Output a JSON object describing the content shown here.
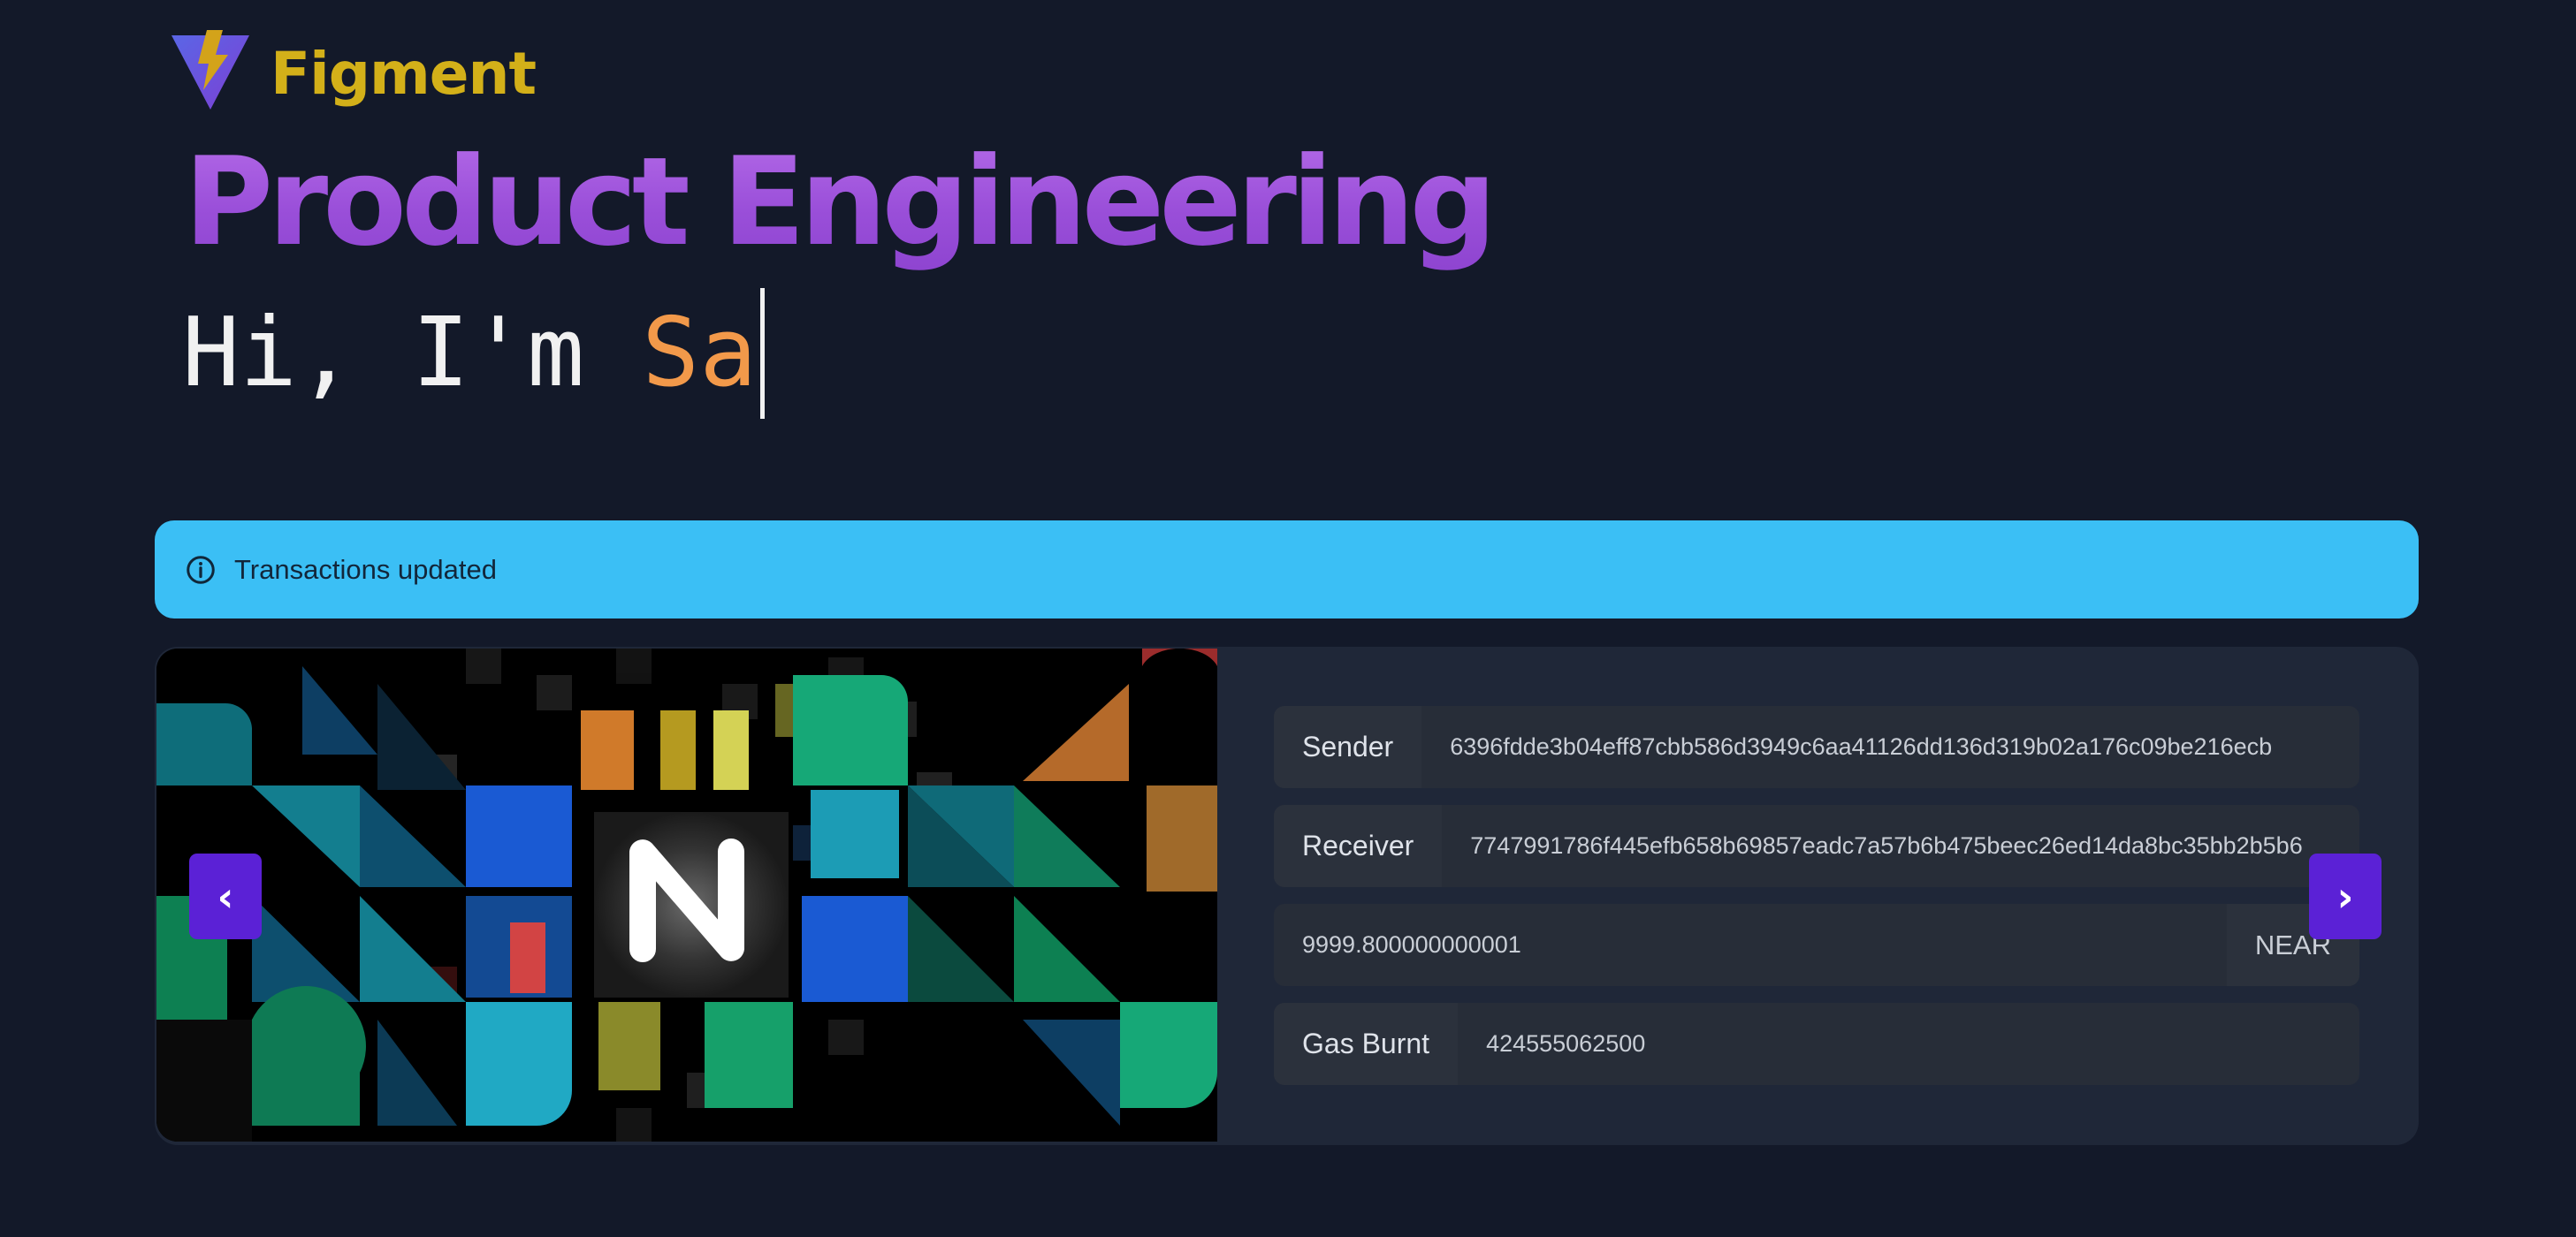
{
  "brand": {
    "name": "Figment",
    "logo_icon": "figment-lightning-logo"
  },
  "hero": {
    "title": "Product Engineering",
    "typing_static": "Hi, I'm ",
    "typing_dynamic": "Sa"
  },
  "alert": {
    "icon": "info-circle-icon",
    "text": "Transactions updated",
    "color": "#3bbff5"
  },
  "transaction": {
    "image_icon": "near-protocol-logo",
    "sender_label": "Sender",
    "sender_value": "6396fdde3b04eff87cbb586d3949c6aa41126dd136d319b02a176c09be216ecb",
    "receiver_label": "Receiver",
    "receiver_value": "7747991786f445efb658b69857eadc7a57b6b475beec26ed14da8bc35bb2b5b6",
    "amount_value": "9999.800000000001",
    "amount_unit": "NEAR",
    "gas_label": "Gas Burnt",
    "gas_value": "424555062500"
  },
  "carousel": {
    "prev_label": "‹",
    "next_label": "›"
  },
  "colors": {
    "background": "#131929",
    "title_gradient": "#a35ae0",
    "brand": "#d3b019",
    "accent_button": "#5b21d6",
    "typing_highlight": "#f2994a"
  }
}
